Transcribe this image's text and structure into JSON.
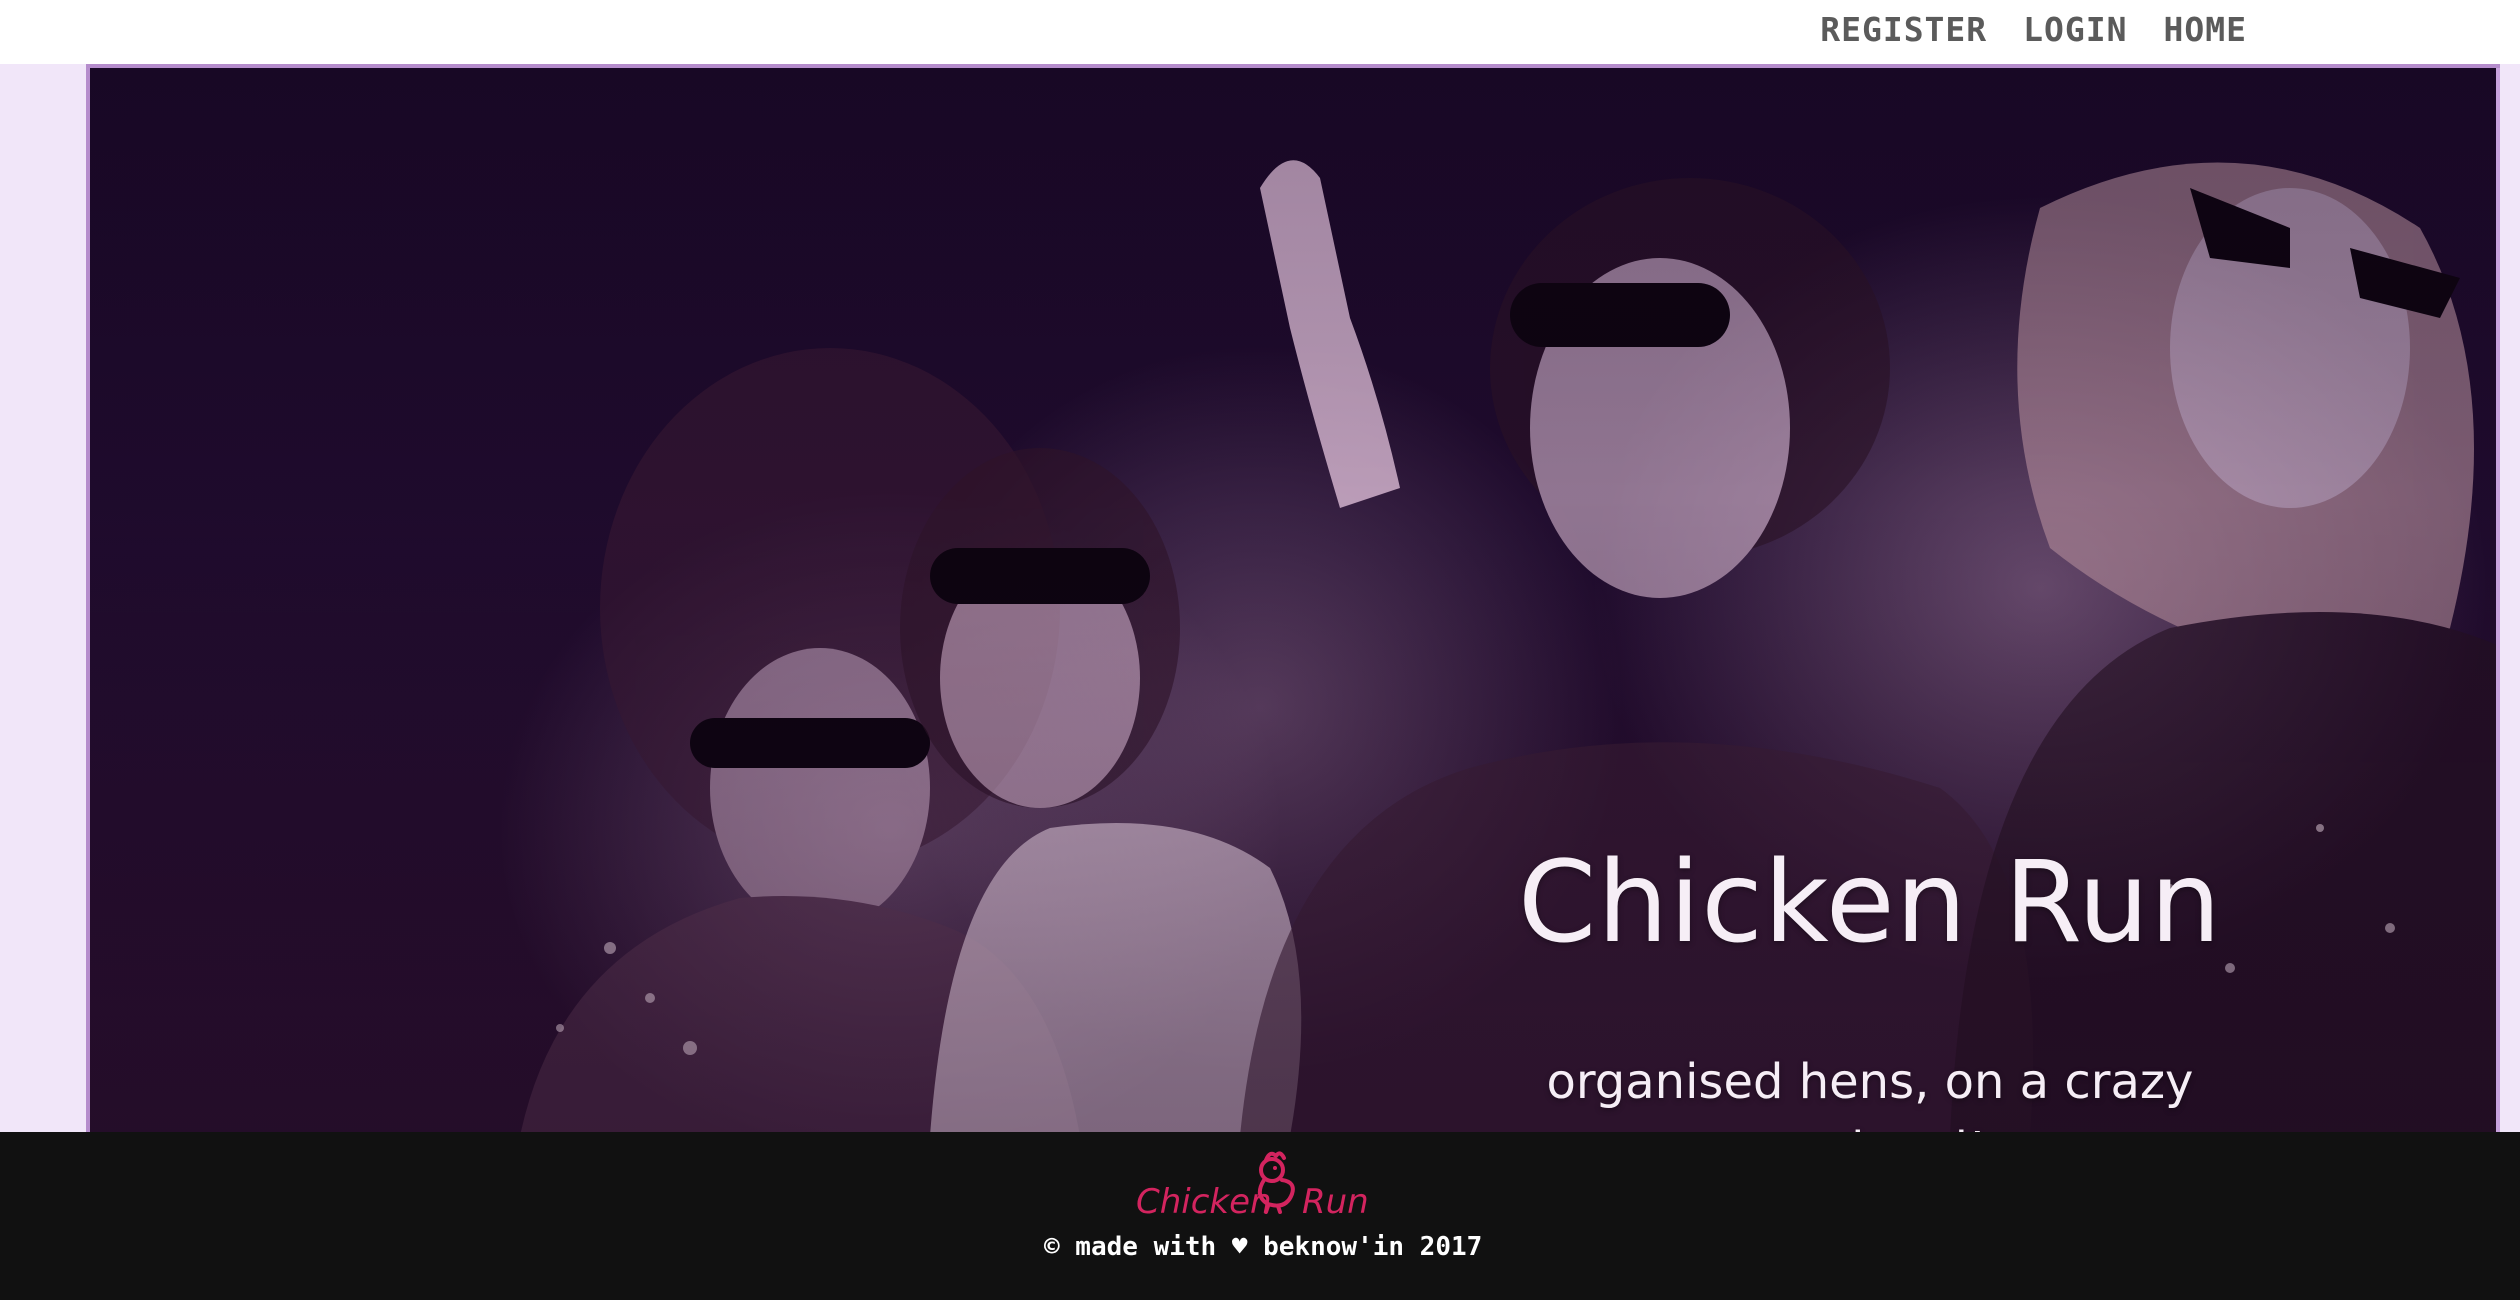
{
  "nav": {
    "items": [
      "REGISTER",
      "LOGIN",
      "HOME"
    ]
  },
  "hero": {
    "title": "Chicken Run",
    "subtitle": "organised hens, on a crazy weekend!",
    "image_alt_icon": "photo-of-four-women-in-sunglasses"
  },
  "footer": {
    "logo": {
      "left": "Chicken",
      "right": "Run",
      "icon": "chick-icon"
    },
    "copyright": "© made with ♥ beknow'in 2017"
  },
  "colors": {
    "nav_text": "#5b5b5b",
    "side_strip": "#f1e6f9",
    "hero_dark": "#190826",
    "hero_text": "#f6eef6",
    "footer_bg": "#111111",
    "logo_pink": "#d3245f"
  }
}
